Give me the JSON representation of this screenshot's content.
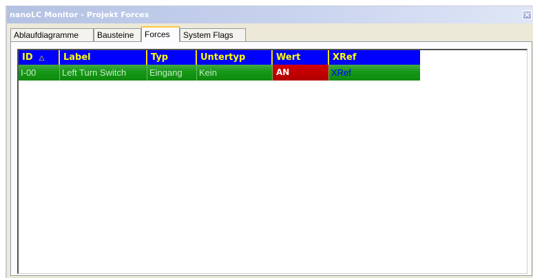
{
  "window": {
    "title": "nanoLC Monitor - Projekt Forces",
    "close_glyph": "×"
  },
  "tabs": [
    {
      "label": "Ablaufdiagramme",
      "active": false
    },
    {
      "label": "Bausteine",
      "active": false
    },
    {
      "label": "Forces",
      "active": true
    },
    {
      "label": "System Flags",
      "active": false
    }
  ],
  "table": {
    "columns": [
      "ID",
      "Label",
      "Typ",
      "Untertyp",
      "Wert",
      "XRef"
    ],
    "sort_glyph": "△",
    "rows": [
      {
        "ID": "I-00",
        "Label": "Left Turn Switch",
        "Typ": "Eingang",
        "Untertyp": "Kein",
        "Wert": "AN",
        "XRef": "XRef"
      }
    ]
  },
  "colors": {
    "header_bg": "#0000ff",
    "header_text": "#ffff00",
    "row_bg": "#159815",
    "wert_bg": "#c80000",
    "xref_text": "#0000ff"
  }
}
